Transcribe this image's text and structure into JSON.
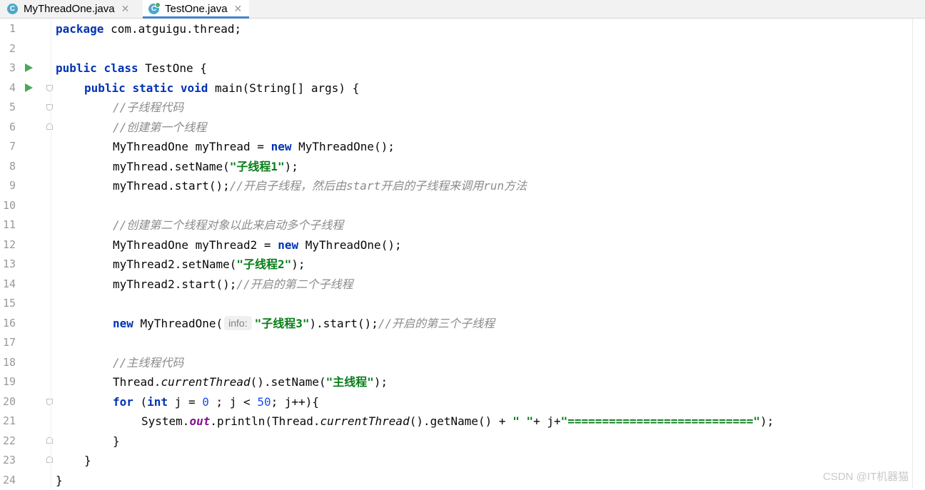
{
  "tabs": [
    {
      "label": "MyThreadOne.java",
      "icon": "java-class-icon",
      "active": false
    },
    {
      "label": "TestOne.java",
      "icon": "java-class-runnable-icon",
      "active": true
    }
  ],
  "tab_icon_letter": "C",
  "tab_close_glyph": "✕",
  "colors": {
    "keyword": "#0033b3",
    "string": "#067d17",
    "comment": "#8c8c8c",
    "number": "#1750eb",
    "static_field": "#871094",
    "run_icon": "#4aa85c",
    "active_tab_underline": "#4083c9"
  },
  "line_numbers": [
    "1",
    "2",
    "3",
    "4",
    "5",
    "6",
    "7",
    "8",
    "9",
    "10",
    "11",
    "12",
    "13",
    "14",
    "15",
    "16",
    "17",
    "18",
    "19",
    "20",
    "21",
    "22",
    "23",
    "24"
  ],
  "run_markers": {
    "lines": [
      "3",
      "4"
    ],
    "icon": "run-triangle-icon"
  },
  "fold_markers": [
    {
      "line": "4",
      "kind": "open"
    },
    {
      "line": "5",
      "kind": "open"
    },
    {
      "line": "6",
      "kind": "close"
    },
    {
      "line": "20",
      "kind": "open"
    },
    {
      "line": "22",
      "kind": "close"
    },
    {
      "line": "23",
      "kind": "close"
    }
  ],
  "code": {
    "l1": {
      "kw": "package",
      "rest": " com.atguigu.thread;"
    },
    "l3": {
      "kw1": "public",
      "kw2": "class",
      "rest": " TestOne {"
    },
    "l4": {
      "kw1": "public",
      "kw2": "static",
      "kw3": "void",
      "rest": " main(String[] args) {"
    },
    "l5": {
      "comment": "//子线程代码"
    },
    "l6": {
      "comment": "//创建第一个线程"
    },
    "l7": {
      "pre": "MyThreadOne myThread = ",
      "kw": "new",
      "post": " MyThreadOne();"
    },
    "l8": {
      "pre": "myThread.setName(",
      "str": "\"子线程1\"",
      "post": ");"
    },
    "l9": {
      "pre": "myThread.start();",
      "comment": "//开启子线程，然后由start开启的子线程来调用run方法"
    },
    "l11": {
      "comment": "//创建第二个线程对象以此来启动多个子线程"
    },
    "l12": {
      "pre": "MyThreadOne myThread2 = ",
      "kw": "new",
      "post": " MyThreadOne();"
    },
    "l13": {
      "pre": "myThread2.setName(",
      "str": "\"子线程2\"",
      "post": ");"
    },
    "l14": {
      "pre": "myThread2.start();",
      "comment": "//开启的第二个子线程"
    },
    "l16": {
      "kw": "new",
      "pre": " MyThreadOne(",
      "hint": "info:",
      "str": "\"子线程3\"",
      "post": ").start();",
      "comment": "//开启的第三个子线程"
    },
    "l18": {
      "comment": "//主线程代码"
    },
    "l19": {
      "pre": "Thread.",
      "it": "currentThread",
      "mid": "().setName(",
      "str": "\"主线程\"",
      "post": ");"
    },
    "l20": {
      "kw1": "for",
      "a": " (",
      "kw2": "int",
      "b": " j = ",
      "n1": "0",
      "c": " ; j < ",
      "n2": "50",
      "d": "; j++){"
    },
    "l21": {
      "a": "System.",
      "field": "out",
      "b": ".println(Thread.",
      "it": "currentThread",
      "c": "().getName() + ",
      "s1": "\" \"",
      "d": "+ j+",
      "s2": "\"===========================\"",
      "e": ");"
    },
    "l22": {
      "text": "}"
    },
    "l23": {
      "text": "}"
    },
    "l24": {
      "text": "}"
    }
  },
  "watermark": "CSDN @IT机器猫"
}
